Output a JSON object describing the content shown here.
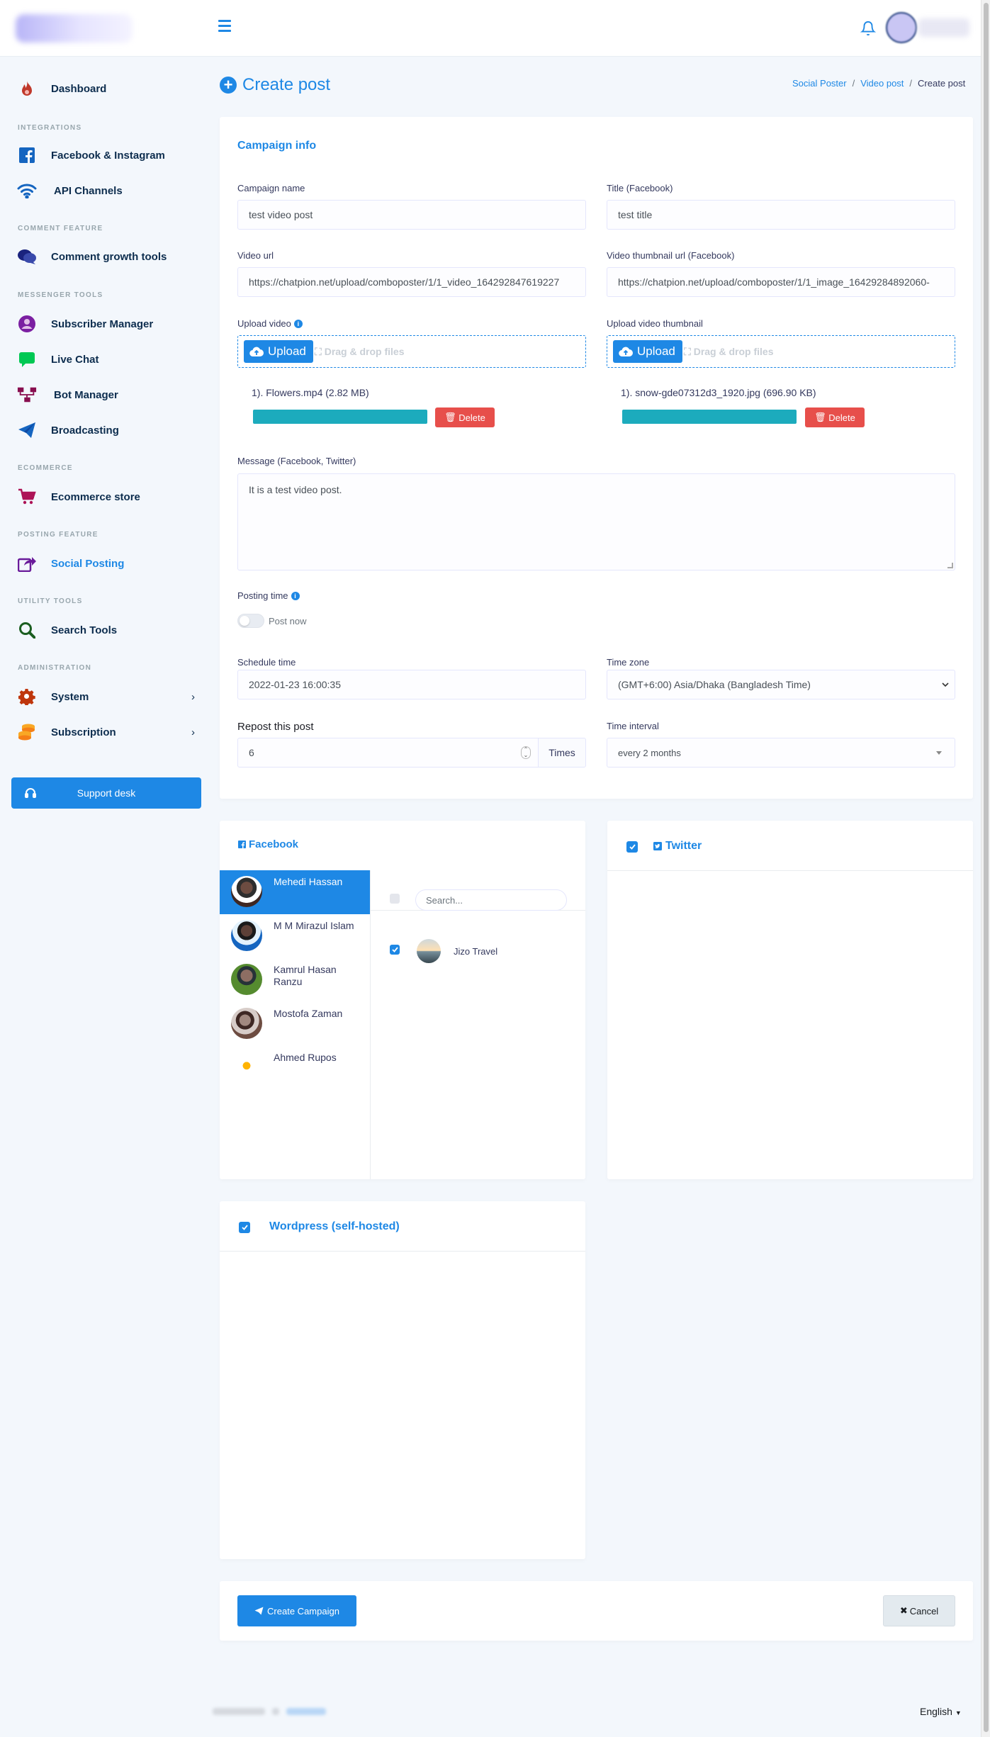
{
  "colors": {
    "primary": "#1e88e5",
    "danger": "#e74f4b",
    "progress": "#1cabbd",
    "sidebar_text": "#0d2d4e",
    "section_heading": "#98a6ad"
  },
  "sidebar": {
    "dashboard": "Dashboard",
    "sec_integrations": "INTEGRATIONS",
    "facebook_instagram": "Facebook & Instagram",
    "api_channels": "API Channels",
    "sec_comment": "COMMENT FEATURE",
    "comment_growth": "Comment growth tools",
    "sec_messenger": "MESSENGER TOOLS",
    "subscriber_manager": "Subscriber Manager",
    "live_chat": "Live Chat",
    "bot_manager": "Bot Manager",
    "broadcasting": "Broadcasting",
    "sec_ecommerce": "ECOMMERCE",
    "ecommerce_store": "Ecommerce store",
    "sec_posting": "POSTING FEATURE",
    "social_posting": "Social Posting",
    "sec_utility": "UTILITY TOOLS",
    "search_tools": "Search Tools",
    "sec_admin": "ADMINISTRATION",
    "system": "System",
    "subscription": "Subscription",
    "support_desk": "Support desk",
    "arrow": "›"
  },
  "header": {
    "title": "Create post",
    "plus": "+",
    "breadcrumb": {
      "b1": "Social Poster",
      "b2": "Video post",
      "b3": "Create post",
      "sep": "/"
    }
  },
  "form": {
    "section_title": "Campaign info",
    "campaign_name_label": "Campaign name",
    "campaign_name": "test video post",
    "title_fb_label": "Title (Facebook)",
    "title_fb": "test title",
    "video_url_label": "Video url",
    "video_url": "https://chatpion.net/upload/comboposter/1/1_video_164292847619227",
    "thumb_url_label": "Video thumbnail url (Facebook)",
    "thumb_url": "https://chatpion.net/upload/comboposter/1/1_image_16429284892060-",
    "upload_video_label": "Upload video",
    "upload_thumb_label": "Upload video thumbnail",
    "info": "i",
    "upload_btn": "Upload",
    "drag_text": "Drag & drop files",
    "video_file": "1). Flowers.mp4 (2.82 MB)",
    "video_progress": 1.0,
    "thumb_file": "1). snow-gde07312d3_1920.jpg (696.90 KB)",
    "thumb_progress": 1.0,
    "delete_btn": "Delete",
    "message_label": "Message (Facebook, Twitter)",
    "message": "It is a test video post.",
    "posting_time_label": "Posting time",
    "post_now": "Post now",
    "schedule_label": "Schedule time",
    "schedule_value": "2022-01-23 16:00:35",
    "timezone_label": "Time zone",
    "timezone_value": "(GMT+6:00) Asia/Dhaka (Bangladesh Time)",
    "repost_label": "Repost this post",
    "repost_value": "6",
    "times": "Times",
    "interval_label": "Time interval",
    "interval_value": "every 2 months"
  },
  "facebook": {
    "title": "Facebook",
    "accounts": [
      {
        "name": "Mehedi Hassan"
      },
      {
        "name": "M M Mirazul Islam"
      },
      {
        "name": "Kamrul Hasan Ranzu"
      },
      {
        "name": "Mostofa Zaman"
      },
      {
        "name": "Ahmed Rupos"
      }
    ],
    "search_placeholder": "Search...",
    "page_name": "Jizo Travel"
  },
  "twitter": {
    "title": "Twitter"
  },
  "wordpress": {
    "title": "Wordpress (self-hosted)"
  },
  "actions": {
    "create": "Create Campaign",
    "cancel": "Cancel"
  },
  "footer": {
    "language": "English"
  }
}
